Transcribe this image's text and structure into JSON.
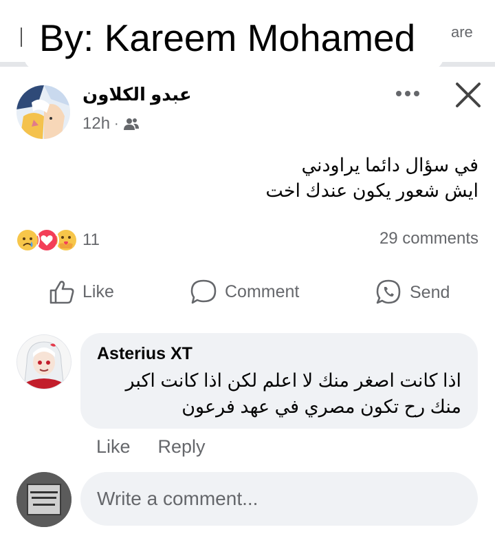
{
  "caption": {
    "text": "By: Kareem Mohamed",
    "right_fragment": "are"
  },
  "post": {
    "author": "عبدو الكلاون",
    "time": "12h",
    "separator": "·",
    "audience_icon": "friends-icon",
    "body_lines": [
      "في سؤال دائما يراودني",
      "ايش شعور يكون عندك اخت"
    ]
  },
  "reactions": {
    "icons": [
      "sad-reaction-icon",
      "love-reaction-icon",
      "care-reaction-icon"
    ],
    "count": "11",
    "comments": "29 comments"
  },
  "actions": {
    "like": "Like",
    "comment": "Comment",
    "send": "Send"
  },
  "comment": {
    "author": "Asterius XT",
    "text_lines": [
      "اذا كانت اصغر منك لا اعلم لكن اذا كانت اكبر",
      "منك رح تكون مصري في عهد فرعون"
    ],
    "like": "Like",
    "reply": "Reply"
  },
  "composer": {
    "placeholder": "Write a comment..."
  },
  "colors": {
    "secondary_text": "#65676b",
    "bubble": "#f0f2f5",
    "love": "#f33e58",
    "haha_yellow": "#f7c64a"
  }
}
